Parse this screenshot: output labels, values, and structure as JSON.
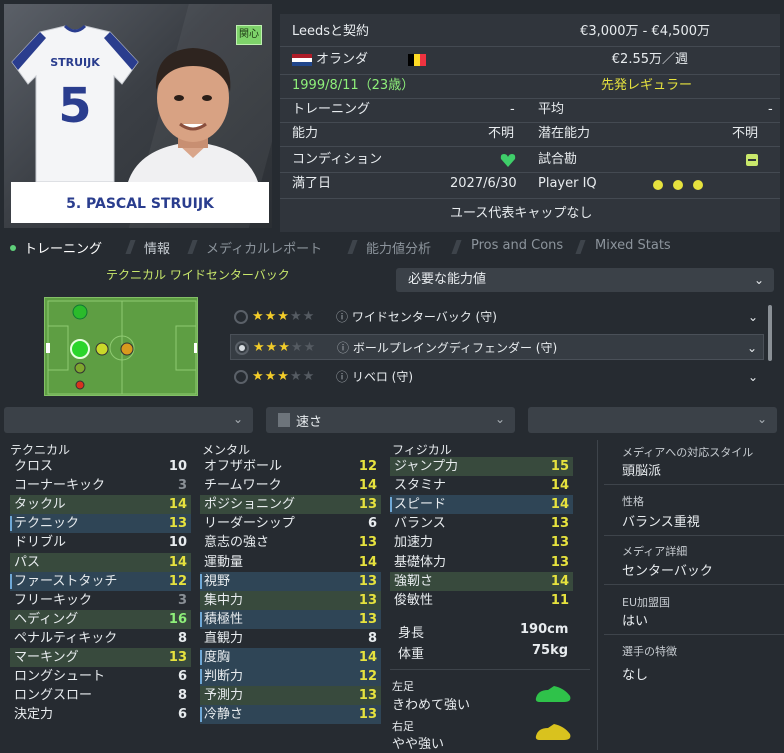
{
  "player": {
    "name_plate": "5. PASCAL STRUIJK",
    "shirt_name": "STRUIJK",
    "shirt_number": "5",
    "interest_badge": "関心"
  },
  "info": {
    "contract": "Leedsと契約",
    "value_range": "€3,000万 - €4,500万",
    "nationality": "オランダ",
    "wage": "€2.55万／週",
    "birth": "1999/8/11（23歳）",
    "squad_status": "先発レギュラー",
    "training_label": "トレーニング",
    "training_value": "-",
    "average_label": "平均",
    "average_value": "-",
    "ability_label": "能力",
    "ability_value": "不明",
    "potential_label": "潜在能力",
    "potential_value": "不明",
    "condition_label": "コンディション",
    "match_fitness_label": "試合勘",
    "contract_end_label": "満了日",
    "contract_end_value": "2027/6/30",
    "player_iq_label": "Player IQ",
    "youth_caps": "ユース代表キャップなし"
  },
  "tabs": [
    {
      "label": "トレーニング",
      "active": true
    },
    {
      "label": "情報"
    },
    {
      "label": "メディカルレポート"
    },
    {
      "label": "能力値分析"
    },
    {
      "label": "Pros and Cons"
    },
    {
      "label": "Mixed Stats"
    }
  ],
  "role_title": "テクニカル ワイドセンターバック",
  "required_select": "必要な能力値",
  "roles": [
    {
      "label": "ワイドセンターバック (守)",
      "stars": 3,
      "selected": false
    },
    {
      "label": "ボールプレイングディフェンダー (守)",
      "stars": 3,
      "selected": true
    },
    {
      "label": "リベロ (守)",
      "stars": 3,
      "selected": false
    }
  ],
  "filters": {
    "speed": "速さ"
  },
  "columns": {
    "technical": {
      "title": "テクニカル",
      "attrs": [
        {
          "name": "クロス",
          "value": "10",
          "style": ""
        },
        {
          "name": "コーナーキック",
          "value": "3",
          "style": "dim"
        },
        {
          "name": "タックル",
          "value": "14",
          "style": "hl"
        },
        {
          "name": "テクニック",
          "value": "13",
          "style": "hlb"
        },
        {
          "name": "ドリブル",
          "value": "10",
          "style": ""
        },
        {
          "name": "パス",
          "value": "14",
          "style": "hl"
        },
        {
          "name": "ファーストタッチ",
          "value": "12",
          "style": "hlb"
        },
        {
          "name": "フリーキック",
          "value": "3",
          "style": "dim"
        },
        {
          "name": "ヘディング",
          "value": "16",
          "style": "hl"
        },
        {
          "name": "ペナルティキック",
          "value": "8",
          "style": ""
        },
        {
          "name": "マーキング",
          "value": "13",
          "style": "hl"
        },
        {
          "name": "ロングシュート",
          "value": "6",
          "style": ""
        },
        {
          "name": "ロングスロー",
          "value": "8",
          "style": ""
        },
        {
          "name": "決定力",
          "value": "6",
          "style": ""
        }
      ]
    },
    "mental": {
      "title": "メンタル",
      "attrs": [
        {
          "name": "オフザボール",
          "value": "12",
          "style": ""
        },
        {
          "name": "チームワーク",
          "value": "14",
          "style": ""
        },
        {
          "name": "ポジショニング",
          "value": "13",
          "style": "hl"
        },
        {
          "name": "リーダーシップ",
          "value": "6",
          "style": ""
        },
        {
          "name": "意志の強さ",
          "value": "13",
          "style": ""
        },
        {
          "name": "運動量",
          "value": "14",
          "style": ""
        },
        {
          "name": "視野",
          "value": "13",
          "style": "hlb"
        },
        {
          "name": "集中力",
          "value": "13",
          "style": "hl"
        },
        {
          "name": "積極性",
          "value": "13",
          "style": "hlb"
        },
        {
          "name": "直観力",
          "value": "8",
          "style": ""
        },
        {
          "name": "度胸",
          "value": "14",
          "style": "hlb"
        },
        {
          "name": "判断力",
          "value": "12",
          "style": "hlb"
        },
        {
          "name": "予測力",
          "value": "13",
          "style": "hl"
        },
        {
          "name": "冷静さ",
          "value": "13",
          "style": "hlb"
        }
      ]
    },
    "physical": {
      "title": "フィジカル",
      "attrs": [
        {
          "name": "ジャンプ力",
          "value": "15",
          "style": "hl"
        },
        {
          "name": "スタミナ",
          "value": "14",
          "style": ""
        },
        {
          "name": "スピード",
          "value": "14",
          "style": "hlb"
        },
        {
          "name": "バランス",
          "value": "13",
          "style": ""
        },
        {
          "name": "加速力",
          "value": "13",
          "style": ""
        },
        {
          "name": "基礎体力",
          "value": "13",
          "style": ""
        },
        {
          "name": "強靭さ",
          "value": "14",
          "style": "hl"
        },
        {
          "name": "俊敏性",
          "value": "11",
          "style": ""
        }
      ]
    }
  },
  "body": {
    "height_label": "身長",
    "height_value": "190cm",
    "weight_label": "体重",
    "weight_value": "75kg",
    "left_foot_label": "左足",
    "left_foot_value": "きわめて強い",
    "right_foot_label": "右足",
    "right_foot_value": "やや強い"
  },
  "media": {
    "style_label": "メディアへの対応スタイル",
    "style_value": "頭脳派",
    "personality_label": "性格",
    "personality_value": "バランス重視",
    "description_label": "メディア詳細",
    "description_value": "センターバック",
    "eu_label": "EU加盟国",
    "eu_value": "はい",
    "traits_label": "選手の特徴",
    "traits_value": "なし"
  },
  "colors": {
    "accent_green": "#8ef07a",
    "highlight_yellow": "#e6e23e",
    "star": "#f2cc2a",
    "name_blue": "#2a3d8e"
  }
}
